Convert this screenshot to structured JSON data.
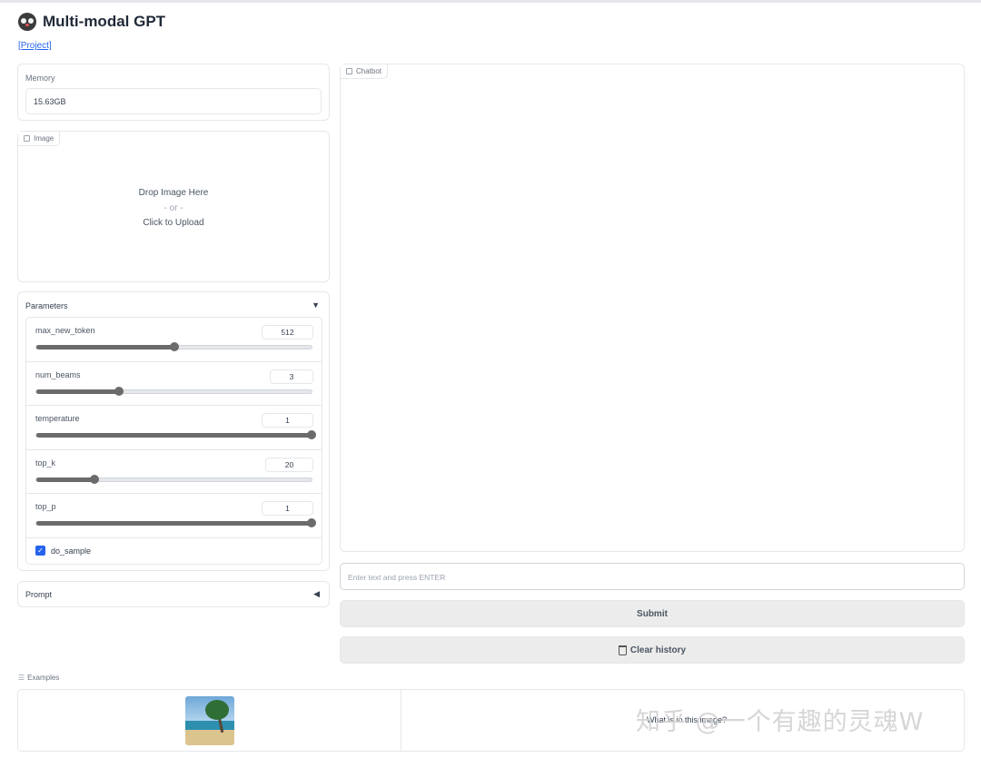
{
  "app": {
    "title": "Multi-modal GPT",
    "project_link": "[Project]"
  },
  "memory": {
    "label": "Memory",
    "value": "15.63GB"
  },
  "image_upload": {
    "tab_label": "Image",
    "drop_text": "Drop Image Here",
    "or_text": "- or -",
    "click_text": "Click to Upload"
  },
  "parameters": {
    "label": "Parameters",
    "items": [
      {
        "name": "max_new_token",
        "value": "512",
        "level": 0.5
      },
      {
        "name": "num_beams",
        "value": "3",
        "level": 0.3
      },
      {
        "name": "temperature",
        "value": "1",
        "level": 1.0
      },
      {
        "name": "top_k",
        "value": "20",
        "level": 0.21
      },
      {
        "name": "top_p",
        "value": "1",
        "level": 1.0
      }
    ],
    "do_sample": {
      "label": "do_sample",
      "checked": true
    }
  },
  "prompt": {
    "label": "Prompt"
  },
  "chatbot": {
    "tab_label": "Chatbot"
  },
  "input": {
    "placeholder": "Enter text and press ENTER"
  },
  "buttons": {
    "submit": "Submit",
    "clear": "Clear history"
  },
  "examples": {
    "label": "Examples",
    "rows": [
      {
        "text": "What is in this image?"
      }
    ]
  },
  "watermark": "知乎 @一个有趣的灵魂W",
  "colors": {
    "accent": "#2563eb",
    "slider": "#6b6b6b",
    "button_bg": "#ececec"
  }
}
